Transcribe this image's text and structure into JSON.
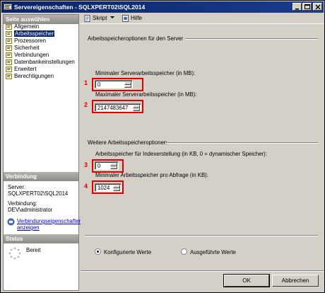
{
  "window": {
    "title": "Servereigenschaften - SQLXPERT02\\SQL2014",
    "buttons": [
      "minimize",
      "maximize",
      "close"
    ]
  },
  "left": {
    "section_header": "Seite auswählen",
    "items": [
      {
        "label": "Allgemein",
        "icon": "page-icon",
        "selected": false
      },
      {
        "label": "Arbeitsspeicher",
        "icon": "page-icon",
        "selected": true
      },
      {
        "label": "Prozessoren",
        "icon": "page-icon",
        "selected": false
      },
      {
        "label": "Sicherheit",
        "icon": "page-icon",
        "selected": false
      },
      {
        "label": "Verbindungen",
        "icon": "page-icon",
        "selected": false
      },
      {
        "label": "Datenbankeinstellungen",
        "icon": "page-icon",
        "selected": false
      },
      {
        "label": "Erweitert",
        "icon": "page-icon",
        "selected": false
      },
      {
        "label": "Berechtigungen",
        "icon": "page-icon",
        "selected": false
      }
    ],
    "connection": {
      "header": "Verbindung",
      "server_label": "Server:",
      "server_value": "SQLXPERT02\\SQL2014",
      "connection_label": "Verbindung:",
      "connection_value": "DEV\\administrator",
      "link_line1": "Verbindungseigenschaften",
      "link_line2": "anzeigen"
    },
    "status": {
      "header": "Status",
      "text": "Bereit"
    }
  },
  "toolbar": {
    "script_label": "Skript",
    "help_label": "Hilfe"
  },
  "main": {
    "group1_title": "Arbeitsspeicheroptionen für den Server",
    "min_label": "Minimaler Serverarbeitsspeicher (in MB):",
    "min_value": "0",
    "max_label": "Maximaler Serverarbeitsspeicher (in MB):",
    "max_value": "2147483647",
    "group2_title": "Weitere Arbeitsspeicheroptionen",
    "index_label": "Arbeitsspeicher für Indexerstellung (in KB, 0 = dynamischer Speicher):",
    "index_value": "0",
    "query_label": "Minimaler Arbeitsspeicher pro Abfrage (in KB):",
    "query_value": "1024",
    "radio_configured": "Konfigurierte Werte",
    "radio_running": "Ausgeführte Werte",
    "radio_selected": "configured"
  },
  "annotations": [
    "1",
    "2",
    "3",
    "4"
  ],
  "footer": {
    "ok_label": "OK",
    "cancel_label": "Abbrechen"
  },
  "colors": {
    "highlight": "#e00000",
    "selection": "#0a246a",
    "link": "#0000cc"
  }
}
